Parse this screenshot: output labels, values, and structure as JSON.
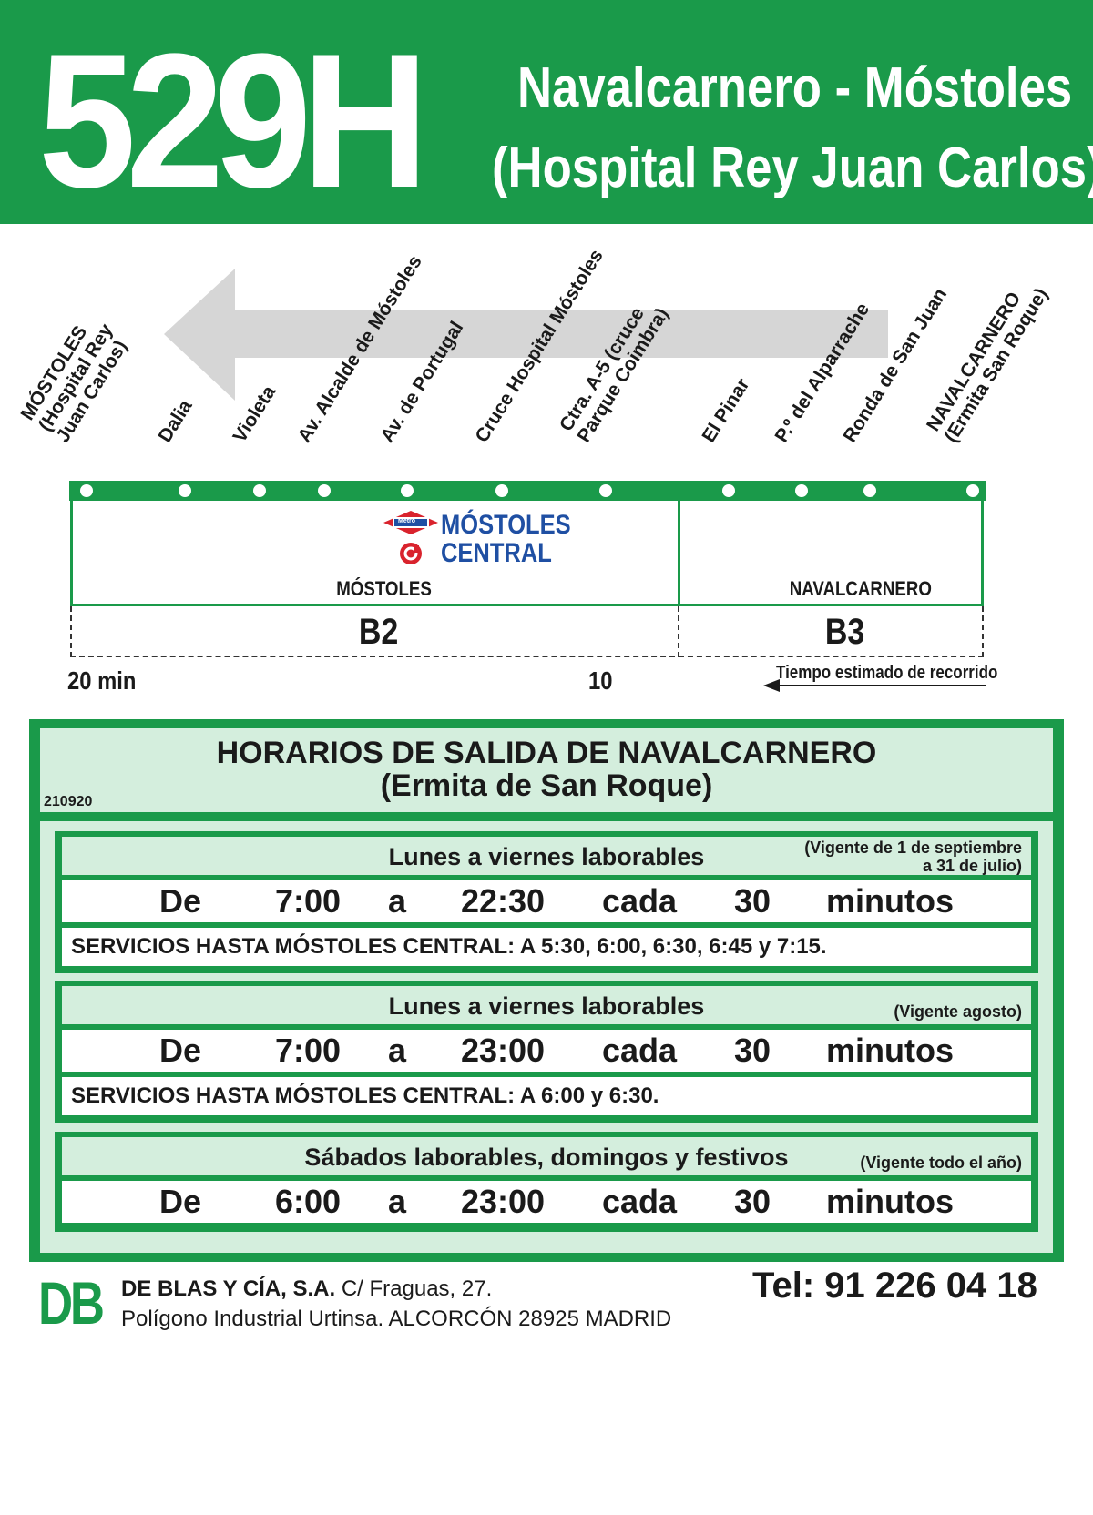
{
  "header": {
    "route_number": "529H",
    "route_name_line1": "Navalcarnero - Móstoles",
    "route_name_line2": "(Hospital Rey Juan Carlos)"
  },
  "stops": [
    {
      "lines": [
        "MÓSTOLES",
        "(Hospital Rey",
        "Juan Carlos)"
      ]
    },
    {
      "lines": [
        "Dalia"
      ]
    },
    {
      "lines": [
        "Violeta"
      ]
    },
    {
      "lines": [
        "Av. Alcalde de Móstoles"
      ]
    },
    {
      "lines": [
        "Av. de Portugal"
      ]
    },
    {
      "lines": [
        "Cruce Hospital Móstoles"
      ]
    },
    {
      "lines": [
        "Ctra. A-5 (cruce",
        "Parque Coimbra)"
      ]
    },
    {
      "lines": [
        "El Pinar"
      ]
    },
    {
      "lines": [
        "P.º del Alparrache"
      ]
    },
    {
      "lines": [
        "Ronda de San Juan"
      ]
    },
    {
      "lines": [
        "NAVALCARNERO",
        "(Ermita San Roque)"
      ]
    }
  ],
  "interchange": {
    "metro_badge": "Metro",
    "line1": "MÓSTOLES",
    "line2": "CENTRAL"
  },
  "zones": {
    "left_town": "MÓSTOLES",
    "right_town": "NAVALCARNERO",
    "left_fare": "B2",
    "right_fare": "B3"
  },
  "travel_time": {
    "start": "20 min",
    "mid": "10",
    "note": "Tiempo estimado de recorrido"
  },
  "timetable": {
    "title_line1": "HORARIOS DE SALIDA DE NAVALCARNERO",
    "title_line2": "(Ermita de San Roque)",
    "code": "210920",
    "schedules": [
      {
        "days": "Lunes a viernes laborables",
        "validity": [
          "(Vigente de 1 de septiembre",
          "a 31 de julio)"
        ],
        "from_word": "De",
        "from": "7:00",
        "to_word": "a",
        "to": "22:30",
        "every_word": "cada",
        "every": "30",
        "unit": "minutos",
        "extra": "SERVICIOS HASTA MÓSTOLES CENTRAL: A 5:30, 6:00, 6:30, 6:45 y 7:15."
      },
      {
        "days": "Lunes a viernes laborables",
        "validity": [
          "(Vigente agosto)"
        ],
        "from_word": "De",
        "from": "7:00",
        "to_word": "a",
        "to": "23:00",
        "every_word": "cada",
        "every": "30",
        "unit": "minutos",
        "extra": "SERVICIOS HASTA MÓSTOLES CENTRAL: A 6:00 y 6:30."
      },
      {
        "days": "Sábados laborables, domingos y festivos",
        "validity": [
          "(Vigente todo el año)"
        ],
        "from_word": "De",
        "from": "6:00",
        "to_word": "a",
        "to": "23:00",
        "every_word": "cada",
        "every": "30",
        "unit": "minutos",
        "extra": ""
      }
    ]
  },
  "footer": {
    "logo": "DB",
    "company": "DE BLAS Y CÍA, S.A.",
    "address1": "C/ Fraguas, 27.",
    "address2": "Polígono Industrial Urtinsa. ALCORCÓN 28925 MADRID",
    "phone": "Tel: 91 226 04 18"
  },
  "colors": {
    "brand_green": "#1a9a4a",
    "light_green": "#d4eedd",
    "metro_red": "#d9232d",
    "metro_blue": "#1f4fa3"
  }
}
